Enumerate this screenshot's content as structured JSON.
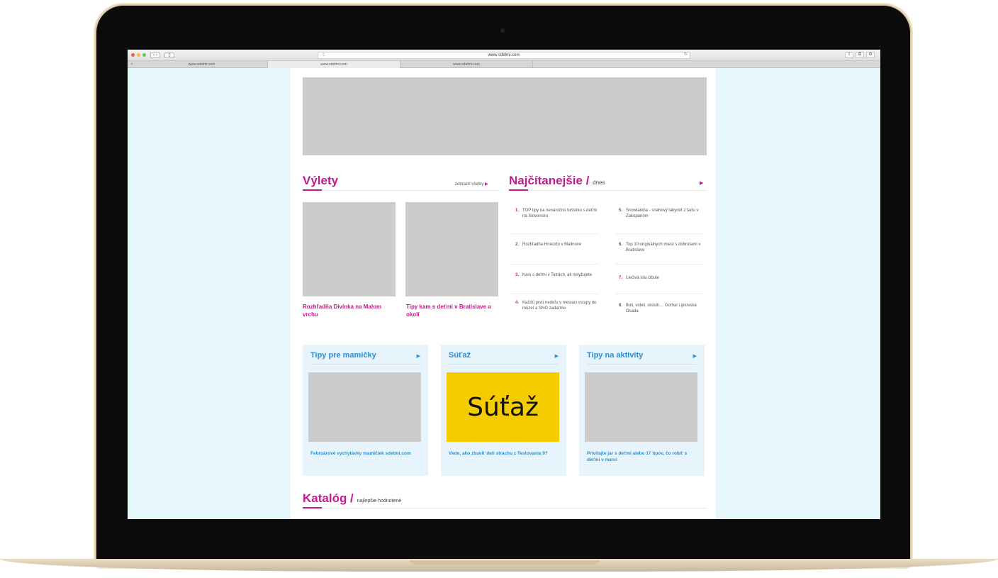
{
  "browser": {
    "url": "www.sdetmi.com",
    "tabs": [
      "www.sdetmi.com",
      "www.sdetmi.com",
      "www.sdetmi.com"
    ]
  },
  "vylety": {
    "title": "Výlety",
    "see_all": "zobraziť všetky",
    "cards": [
      {
        "title": "Rozhľadňa Divinka na Malom vrchu"
      },
      {
        "title": "Tipy kam s deťmi v Bratislave a okolí"
      }
    ]
  },
  "najcitanejsie": {
    "title": "Najčítanejšie /",
    "subtitle": "dnes",
    "items": [
      {
        "num": "1.",
        "text": "TOP tipy na nenáročnú turistiku s deťmi na Slovensku"
      },
      {
        "num": "2.",
        "text": "Rozhľadňa Hniezdo v Malinove"
      },
      {
        "num": "3.",
        "text": "Kam s deťmi v Tatrách, ak nelyžujete"
      },
      {
        "num": "4.",
        "text": "Každú prvú nedeľu v mesiaci vstupy do múzeí a SNG zadarmo"
      },
      {
        "num": "5.",
        "text": "Snowlandia - snehový labyrint z ľadu v Zakopanom"
      },
      {
        "num": "6.",
        "text": "Top 10 originálnych miest s dobrotami v Bratislave"
      },
      {
        "num": "7.",
        "text": "Liečivá sila cibule"
      },
      {
        "num": "8.",
        "text": "Boli, videli, skúsili.... Gothal Liptovská Osada"
      }
    ]
  },
  "boxes": [
    {
      "title": "Tipy pre mamičky",
      "caption": "Februárové vychytávky mamičiek sdetmi.com"
    },
    {
      "title": "Súťaž",
      "image_text": "Súťaž",
      "caption": "Viete, ako zbaviť deti strachu z Testovania 9?"
    },
    {
      "title": "Tipy na aktivity",
      "caption": "Privítajte jar s deťmi alebo 17 tipov, čo robiť s deťmi v marci"
    }
  ],
  "katalog": {
    "title": "Katalóg /",
    "subtitle": "najlepšie hodnotené"
  },
  "colors": {
    "accent": "#c2198c",
    "blue": "#2a8fd0",
    "contest_yellow": "#f5cc00",
    "page_bg": "#e5f7fb"
  }
}
